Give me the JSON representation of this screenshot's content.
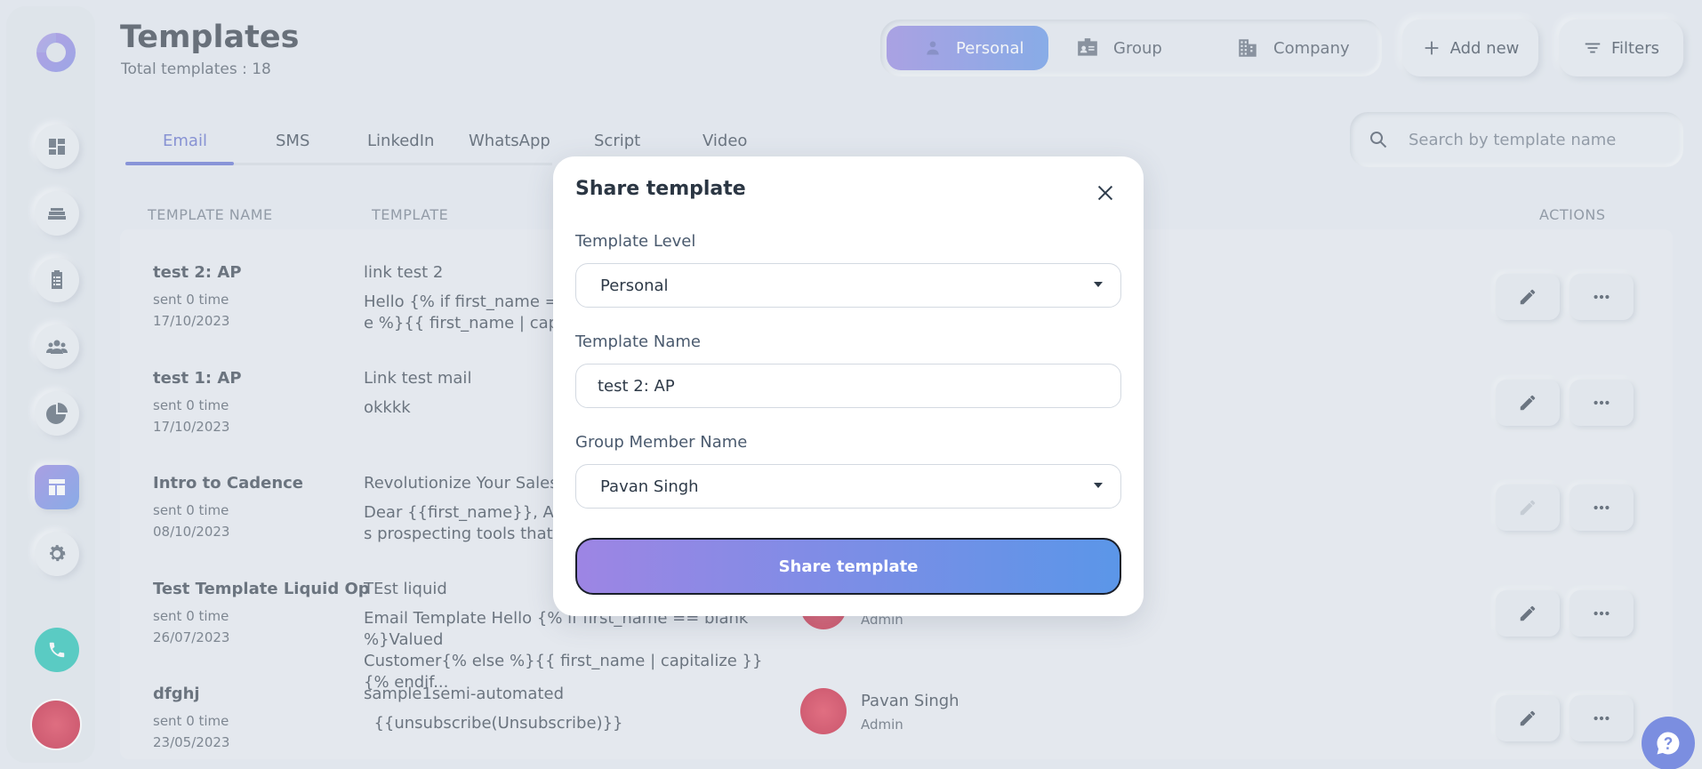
{
  "header": {
    "title": "Templates",
    "subtitle": "Total templates : 18",
    "scopes": [
      {
        "label": "Personal",
        "icon": "person-icon",
        "active": true
      },
      {
        "label": "Group",
        "icon": "id-card-icon",
        "active": false
      },
      {
        "label": "Company",
        "icon": "building-icon",
        "active": false
      }
    ],
    "add_new_label": "Add new",
    "filters_label": "Filters"
  },
  "tabs": [
    "Email",
    "SMS",
    "LinkedIn",
    "WhatsApp",
    "Script",
    "Video"
  ],
  "active_tab": "Email",
  "search": {
    "placeholder": "Search by template name"
  },
  "table": {
    "headers": {
      "name": "TEMPLATE NAME",
      "template": "TEMPLATE",
      "actions": "ACTIONS"
    },
    "rows": [
      {
        "name": "test 2: AP",
        "sent": "sent 0 time",
        "date": "17/10/2023",
        "subject": "link test 2",
        "body": "Hello {% if first_name == b\ne %}{{ first_name | capital"
      },
      {
        "name": "test 1: AP",
        "sent": "sent 0 time",
        "date": "17/10/2023",
        "subject": "Link test mail",
        "body": "okkkk"
      },
      {
        "name": "Intro to Cadence",
        "sent": "sent 0 time",
        "date": "08/10/2023",
        "subject": "Revolutionize Your Sales P",
        "body": "Dear {{first_name}},   Are y\ns prospecting tools that do"
      },
      {
        "name": "Test Template Liquid Op",
        "sent": "sent 0 time",
        "date": "26/07/2023",
        "subject": "TEst liquid",
        "body": "Email Template Hello {% if first_name == blank %}Valued\nCustomer{% else %}{{ first_name | capitalize }}{% endif...",
        "owner": "",
        "role": "Admin"
      },
      {
        "name": "dfghj",
        "sent": "sent 0 time",
        "date": "23/05/2023",
        "subject": "sample1semi-automated",
        "body": "  {{unsubscribe(Unsubscribe)}}",
        "owner": "Pavan Singh",
        "role": "Admin"
      }
    ]
  },
  "modal": {
    "title": "Share template",
    "level_label": "Template Level",
    "level_value": "Personal",
    "name_label": "Template Name",
    "name_value": "test 2: AP",
    "member_label": "Group Member Name",
    "member_value": "Pavan Singh",
    "submit_label": "Share template"
  },
  "colors": {
    "accent_start": "#8f7fe0",
    "accent_end": "#5b8fe6",
    "phone": "#14bfb0"
  }
}
